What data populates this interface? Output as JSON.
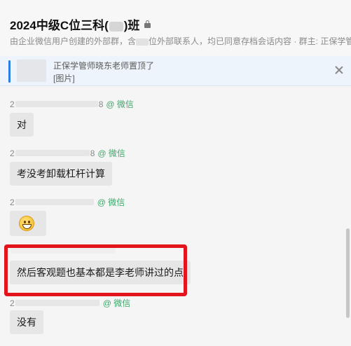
{
  "header": {
    "title_before": "2024中级C位三科(",
    "title_after": ")班",
    "subtitle_before": "由企业微信用户创建的外部群，含",
    "subtitle_after": "位外部联系人，均已同意存档会话内容 · 群主: 正保学管师"
  },
  "pinned": {
    "line1": "正保学管师晓东老师置顶了",
    "line2": "[图片]"
  },
  "messages": [
    {
      "sender_prefix": "2",
      "sender_suffix": "8",
      "source": "@ 微信",
      "text": "对"
    },
    {
      "sender_prefix": "2",
      "sender_suffix": "8",
      "source": "@ 微信",
      "text": "考没考卸载杠杆计算"
    },
    {
      "sender_prefix": "2",
      "sender_suffix": "",
      "source": "@ 微信",
      "emoji": "grinning-face"
    },
    {
      "text": "然后客观题也基本都是李老师讲过的点"
    },
    {
      "sender_prefix": "2",
      "sender_suffix": "",
      "source": "@ 微信",
      "text": "没有"
    }
  ],
  "colors": {
    "accent_blue": "#2e7de0",
    "wechat_green": "#3ea86a",
    "highlight_red": "#e3141b",
    "bubble": "#e6e6e6"
  }
}
